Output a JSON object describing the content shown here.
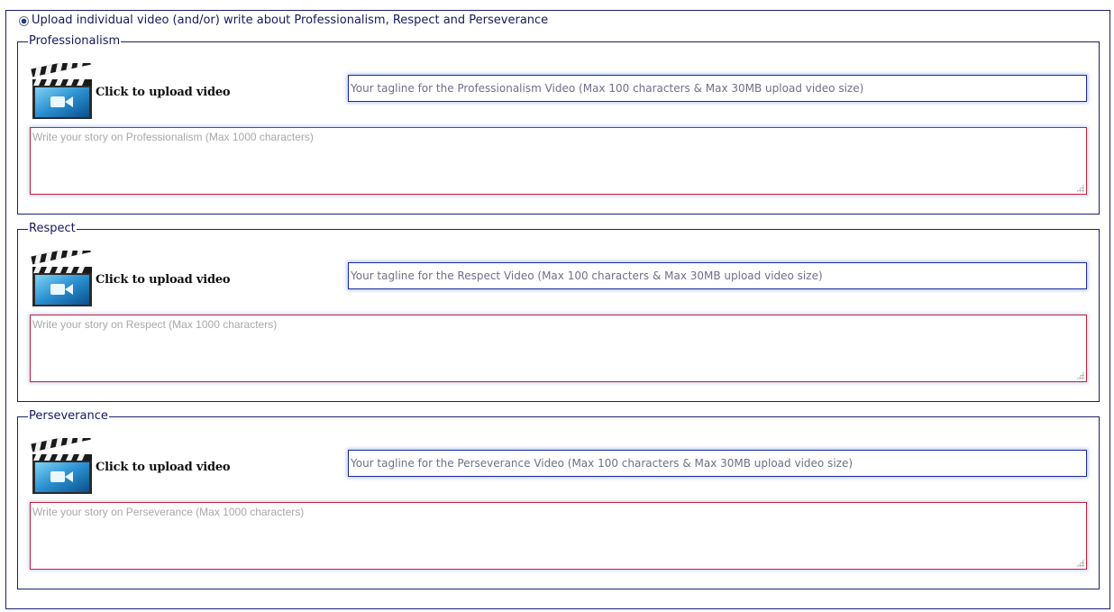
{
  "group": {
    "title": "Upload individual video (and/or) write about Professionalism, Respect and Perseverance",
    "radio_selected": true
  },
  "upload_label": "Click to upload video",
  "sections": [
    {
      "legend": "Professionalism",
      "tagline_placeholder": "Your tagline for the Professionalism Video (Max 100 characters & Max 30MB upload video size)",
      "story_placeholder": "Write your story on Professionalism (Max 1000 characters)"
    },
    {
      "legend": "Respect",
      "tagline_placeholder": "Your tagline for the Respect Video (Max 100 characters & Max 30MB upload video size)",
      "story_placeholder": "Write your story on Respect (Max 1000 characters)"
    },
    {
      "legend": "Perseverance",
      "tagline_placeholder": "Your tagline for the Perseverance Video (Max 100 characters & Max 30MB upload video size)",
      "story_placeholder": "Write your story on Perseverance (Max 1000 characters)"
    }
  ],
  "colors": {
    "frame_border": "#1b1f6b",
    "tagline_border": "#1a2d9c",
    "story_border": "#c4203c",
    "legend_text": "#16195e"
  },
  "icons": {
    "radio": "radio-selected-icon",
    "upload": "clapperboard-video-icon",
    "resize": "resize-grip-icon"
  }
}
